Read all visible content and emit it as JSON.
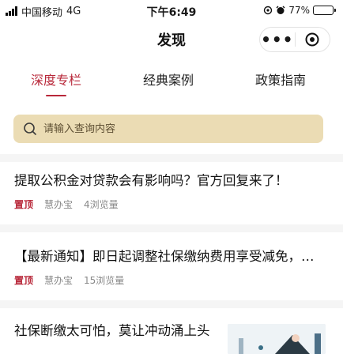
{
  "status_bar": {
    "carrier": "中国移动",
    "network": "4G",
    "time": "下午6:49",
    "battery_percent": "77%",
    "battery_level": 0.77
  },
  "nav": {
    "title": "发现",
    "more_icon": "more-dots-icon",
    "close_icon": "target-close-icon"
  },
  "tabs": [
    {
      "label": "深度专栏",
      "active": true
    },
    {
      "label": "经典案例",
      "active": false
    },
    {
      "label": "政策指南",
      "active": false
    }
  ],
  "search": {
    "placeholder": "请输入查询内容",
    "icon": "search-icon"
  },
  "articles": [
    {
      "title": "提取公积金对贷款会有影响吗？官方回复来了！",
      "pinned": "置顶",
      "source": "慧办宝",
      "views": "4浏览量"
    },
    {
      "title": "【最新通知】即日起调整社保缴纳费用享受减免，…",
      "pinned": "置顶",
      "source": "慧办宝",
      "views": "15浏览量"
    },
    {
      "title": "社保断缴太可怕，莫让冲动涌上头"
    }
  ],
  "colors": {
    "accent": "#b8283a",
    "search_bg": "#ebdcb4",
    "battery": "#43c458"
  }
}
